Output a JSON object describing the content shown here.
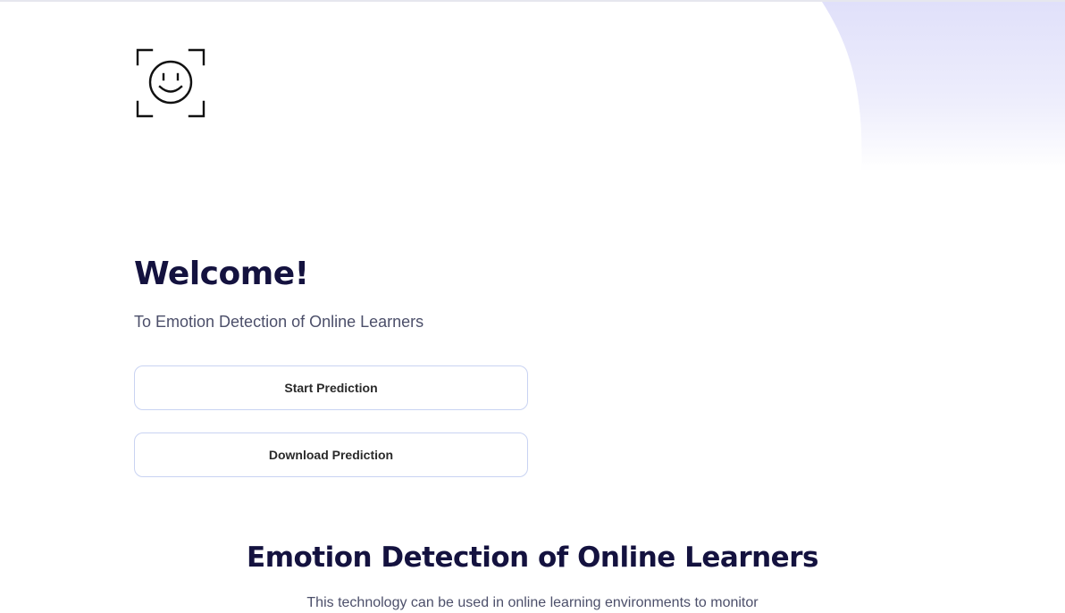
{
  "logo": {
    "icon": "smiley-face-scan-icon"
  },
  "hero": {
    "title": "Welcome!",
    "subtitle": "To Emotion Detection of Online Learners",
    "start_button_label": "Start Prediction",
    "download_button_label": "Download Prediction"
  },
  "about": {
    "title": "Emotion Detection of Online Learners",
    "text": "This technology can be used in online learning environments to monitor"
  },
  "colors": {
    "heading": "#14123f",
    "body_text": "#4c4f6a",
    "button_border": "#c9d3f2",
    "accent_blob": "#e3e2fa"
  }
}
